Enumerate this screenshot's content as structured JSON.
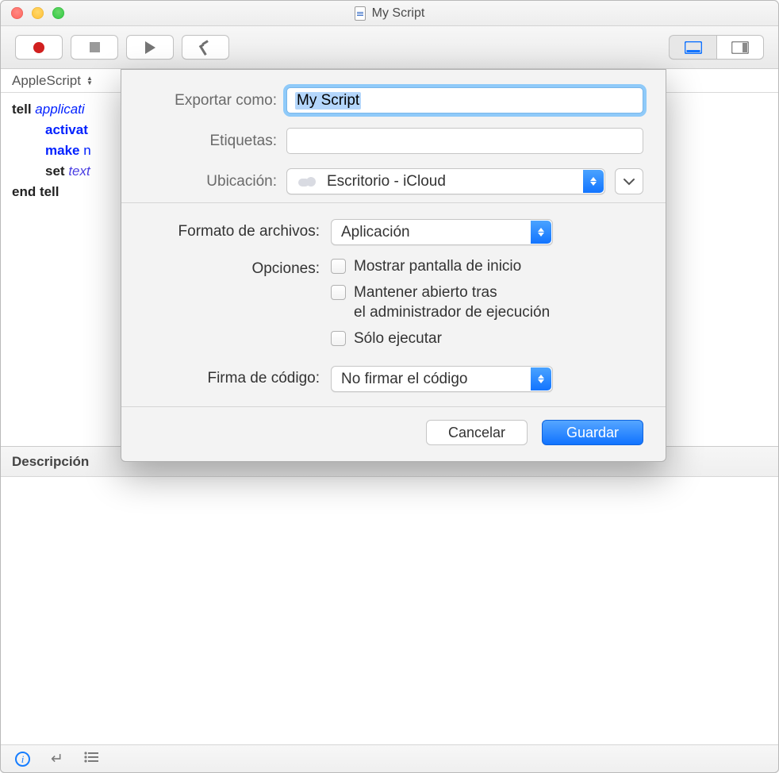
{
  "window": {
    "title": "My Script"
  },
  "toolbar": {
    "icons": [
      "record",
      "stop",
      "play",
      "build"
    ],
    "right_icons": [
      "sidebar-left",
      "sidebar-right"
    ]
  },
  "languageBar": {
    "language": "AppleScript"
  },
  "code": {
    "line1_tell": "tell",
    "line1_application": "applicati",
    "line2_activate": "activat",
    "line3_make": "make",
    "line3_n": "n",
    "line4_set": "set",
    "line4_text": "text",
    "line5_end": "end tell"
  },
  "descriptionBar": {
    "label": "Descripción"
  },
  "statusbar": {
    "icons": [
      "info",
      "return-key",
      "list-view"
    ]
  },
  "sheet": {
    "exportAsLabel": "Exportar como:",
    "exportAsValue": "My Script",
    "tagsLabel": "Etiquetas:",
    "tagsValue": "",
    "locationLabel": "Ubicación:",
    "locationValue": "Escritorio - iCloud",
    "fileFormatLabel": "Formato de archivos:",
    "fileFormatValue": "Aplicación",
    "optionsLabel": "Opciones:",
    "opt1": "Mostrar pantalla de inicio",
    "opt2": "Mantener abierto tras\nel administrador de ejecución",
    "opt3": "Sólo ejecutar",
    "codeSignLabel": "Firma de código:",
    "codeSignValue": "No firmar el código",
    "cancel": "Cancelar",
    "save": "Guardar",
    "colors": {
      "accent": "#1173ff",
      "focusRing": "#8fcaf9"
    }
  }
}
